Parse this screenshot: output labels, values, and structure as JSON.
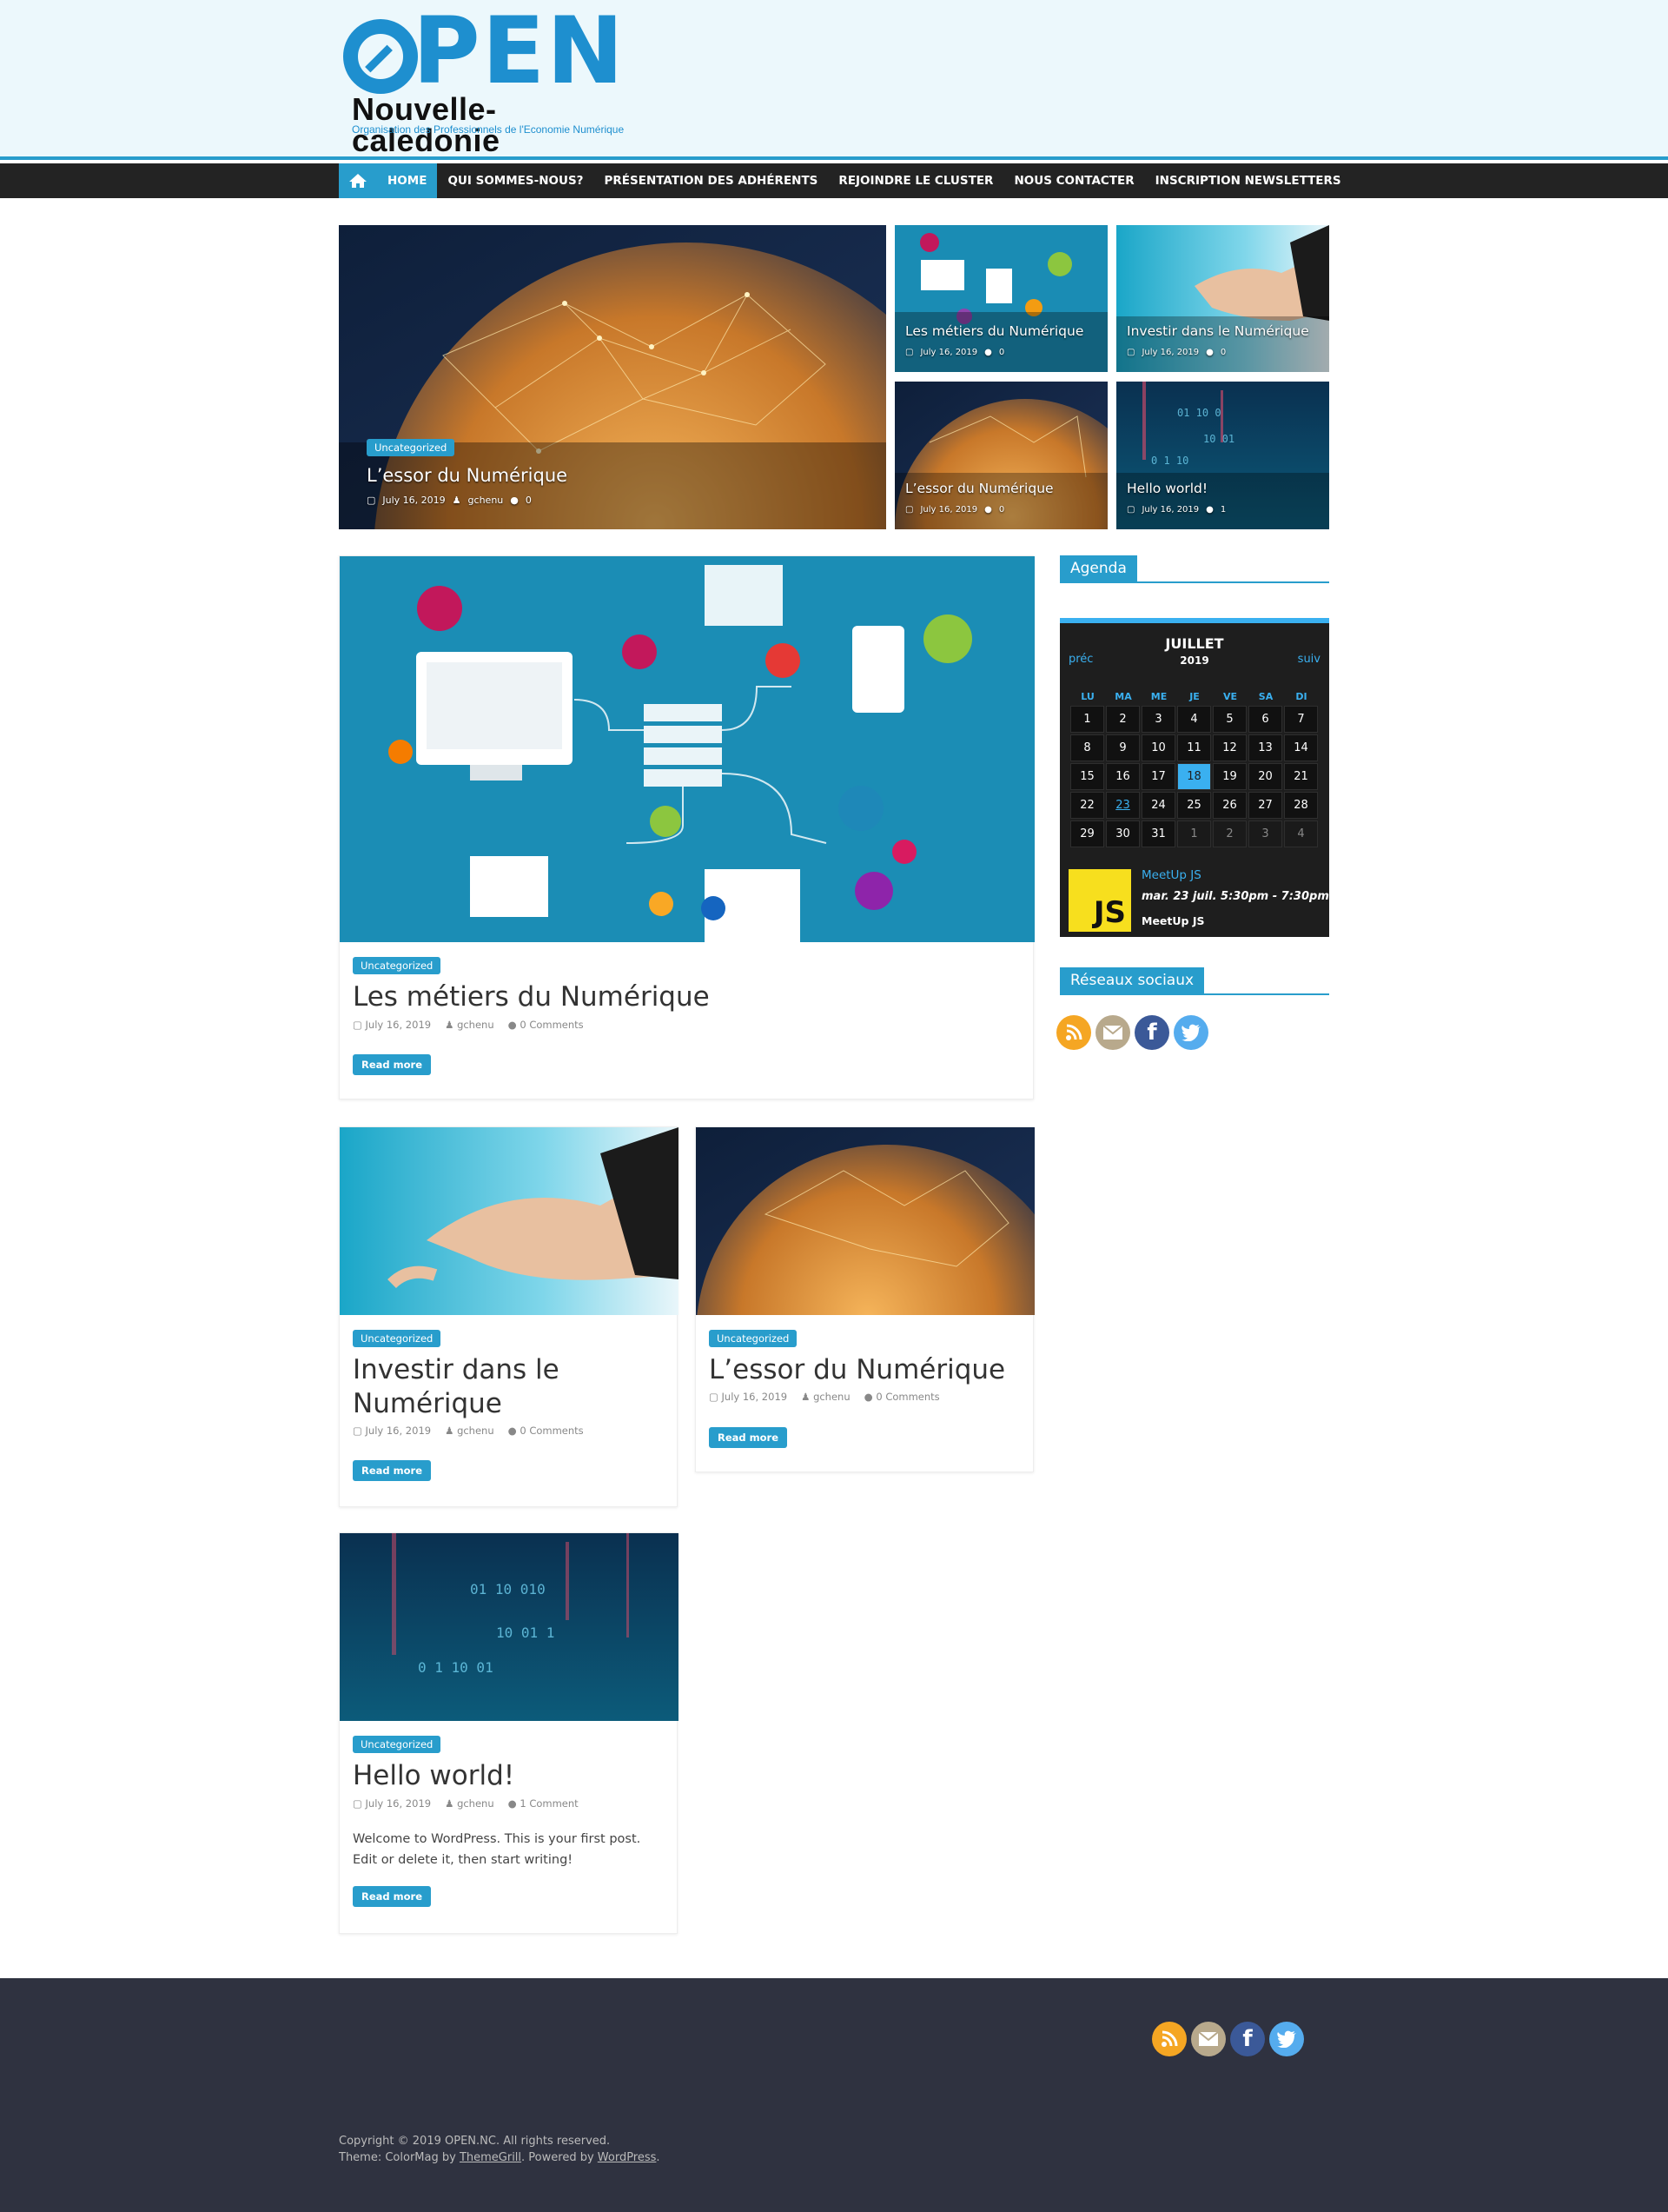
{
  "site": {
    "logo_open": "PEN",
    "logo_subtitle": "Nouvelle-caledonie",
    "logo_tagline": "Organisation des Professionnels de l'Economie Numérique"
  },
  "nav": {
    "items": [
      {
        "label": "HOME",
        "active": true
      },
      {
        "label": "QUI SOMMES-NOUS?"
      },
      {
        "label": "PRÉSENTATION DES ADHÉRENTS"
      },
      {
        "label": "REJOINDRE LE CLUSTER"
      },
      {
        "label": "NOUS CONTACTER"
      },
      {
        "label": "INSCRIPTION NEWSLETTERS"
      }
    ]
  },
  "featured": {
    "main": {
      "category": "Uncategorized",
      "title": "L’essor du Numérique",
      "date": "July 16, 2019",
      "author": "gchenu",
      "comments": "0"
    },
    "small": [
      {
        "title": "Les métiers du Numérique",
        "date": "July 16, 2019",
        "comments": "0"
      },
      {
        "title": "Investir dans le Numérique",
        "date": "July 16, 2019",
        "comments": "0"
      },
      {
        "title": "L’essor du Numérique",
        "date": "July 16, 2019",
        "comments": "0"
      },
      {
        "title": "Hello world!",
        "date": "July 16, 2019",
        "comments": "1"
      }
    ]
  },
  "posts": [
    {
      "category": "Uncategorized",
      "title": "Les métiers du Numérique",
      "date": "July 16, 2019",
      "author": "gchenu",
      "comments": "0 Comments",
      "read_more": "Read more"
    },
    {
      "category": "Uncategorized",
      "title": "Investir dans le Numérique",
      "date": "July 16, 2019",
      "author": "gchenu",
      "comments": "0 Comments",
      "read_more": "Read more"
    },
    {
      "category": "Uncategorized",
      "title": "L’essor du Numérique",
      "date": "July 16, 2019",
      "author": "gchenu",
      "comments": "0 Comments",
      "read_more": "Read more"
    },
    {
      "category": "Uncategorized",
      "title": "Hello world!",
      "date": "July 16, 2019",
      "author": "gchenu",
      "comments": "1 Comment",
      "excerpt": "Welcome to WordPress. This is your first post. Edit or delete it, then start writing!",
      "read_more": "Read more"
    }
  ],
  "sidebar": {
    "agenda_title": "Agenda",
    "calendar": {
      "prev": "préc",
      "next": "suiv",
      "month": "JUILLET",
      "year": "2019",
      "dow": [
        "LU",
        "MA",
        "ME",
        "JE",
        "VE",
        "SA",
        "DI"
      ],
      "weeks": [
        [
          "1",
          "2",
          "3",
          "4",
          "5",
          "6",
          "7"
        ],
        [
          "8",
          "9",
          "10",
          "11",
          "12",
          "13",
          "14"
        ],
        [
          "15",
          "16",
          "17",
          "18",
          "19",
          "20",
          "21"
        ],
        [
          "22",
          "23",
          "24",
          "25",
          "26",
          "27",
          "28"
        ],
        [
          "29",
          "30",
          "31",
          "1",
          "2",
          "3",
          "4"
        ]
      ],
      "today": "18",
      "event_day": "23",
      "event": {
        "logo_text": "JS",
        "title": "MeetUp JS",
        "datetime": "mar. 23 juil. 5:30pm - 7:30pm",
        "location": "MeetUp JS"
      }
    },
    "social_title": "Réseaux sociaux"
  },
  "footer": {
    "copyright": "Copyright © 2019 OPEN.NC. All rights reserved.",
    "theme_prefix": "Theme: ColorMag by ",
    "theme_author": "ThemeGrill",
    "powered_prefix": ". Powered by ",
    "powered_link": "WordPress",
    "powered_suffix": "."
  },
  "colors": {
    "accent": "#289dcc",
    "calendar_accent": "#3ab0f0",
    "footer_bg": "#2f3240",
    "nav_bg": "#232323"
  },
  "icons": [
    "home-icon",
    "calendar-icon",
    "user-icon",
    "comment-icon",
    "rss-icon",
    "mail-icon",
    "facebook-icon",
    "twitter-icon"
  ]
}
